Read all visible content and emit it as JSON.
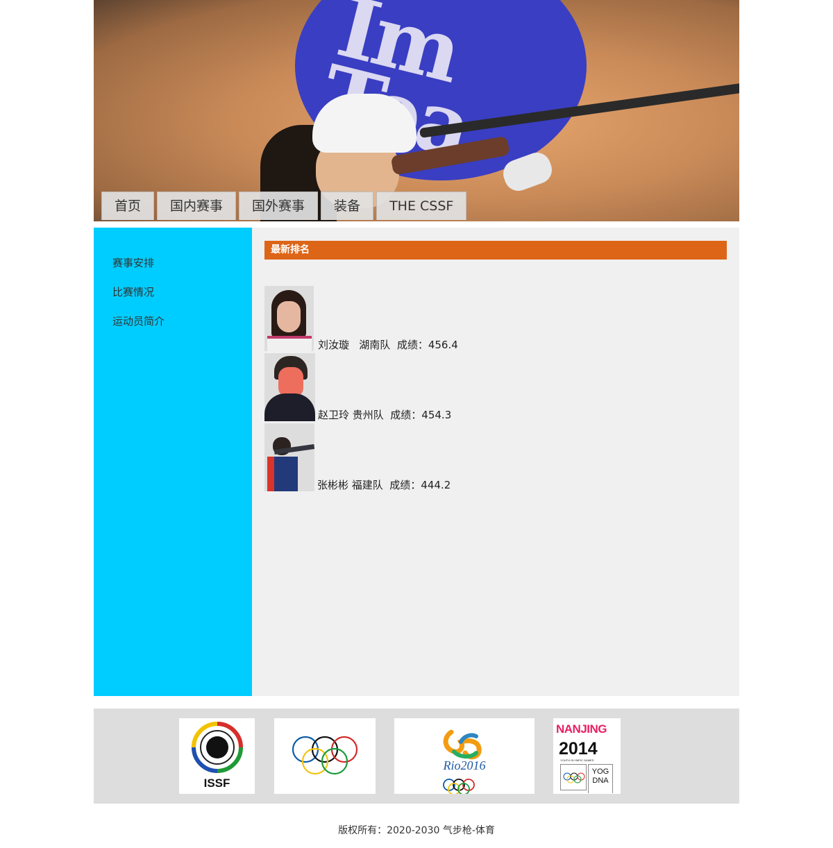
{
  "nav": {
    "tabs": [
      {
        "label": "首页"
      },
      {
        "label": "国内赛事"
      },
      {
        "label": "国外赛事"
      },
      {
        "label": "装备"
      },
      {
        "label": "THE CSSF"
      }
    ]
  },
  "sidebar": {
    "items": [
      {
        "label": "赛事安排"
      },
      {
        "label": "比赛情况"
      },
      {
        "label": "运动员简介"
      }
    ]
  },
  "main": {
    "heading": "最新排名",
    "rankings": [
      {
        "caption": "刘汝璇   湖南队  成绩：456.4"
      },
      {
        "caption": "赵卫玲 贵州队  成绩：454.3"
      },
      {
        "caption": "张彬彬 福建队  成绩：444.2"
      }
    ]
  },
  "logos": {
    "issf_text": "ISSF",
    "rio_text": "Rio2016",
    "nanjing_text": "NANJING",
    "nanjing_year": "2014",
    "nanjing_sub": "YOUTH OLYMPIC GAMES",
    "yog_text": "YOG",
    "dna_text": "DNA"
  },
  "colors": {
    "sidebar_bg": "#00cdff",
    "heading_bg": "#dd6517",
    "content_bg": "#f0f0f0",
    "footer_bg": "#dddddd"
  },
  "footer": {
    "copyright": "版权所有：2020-2030 气步枪-体育"
  }
}
